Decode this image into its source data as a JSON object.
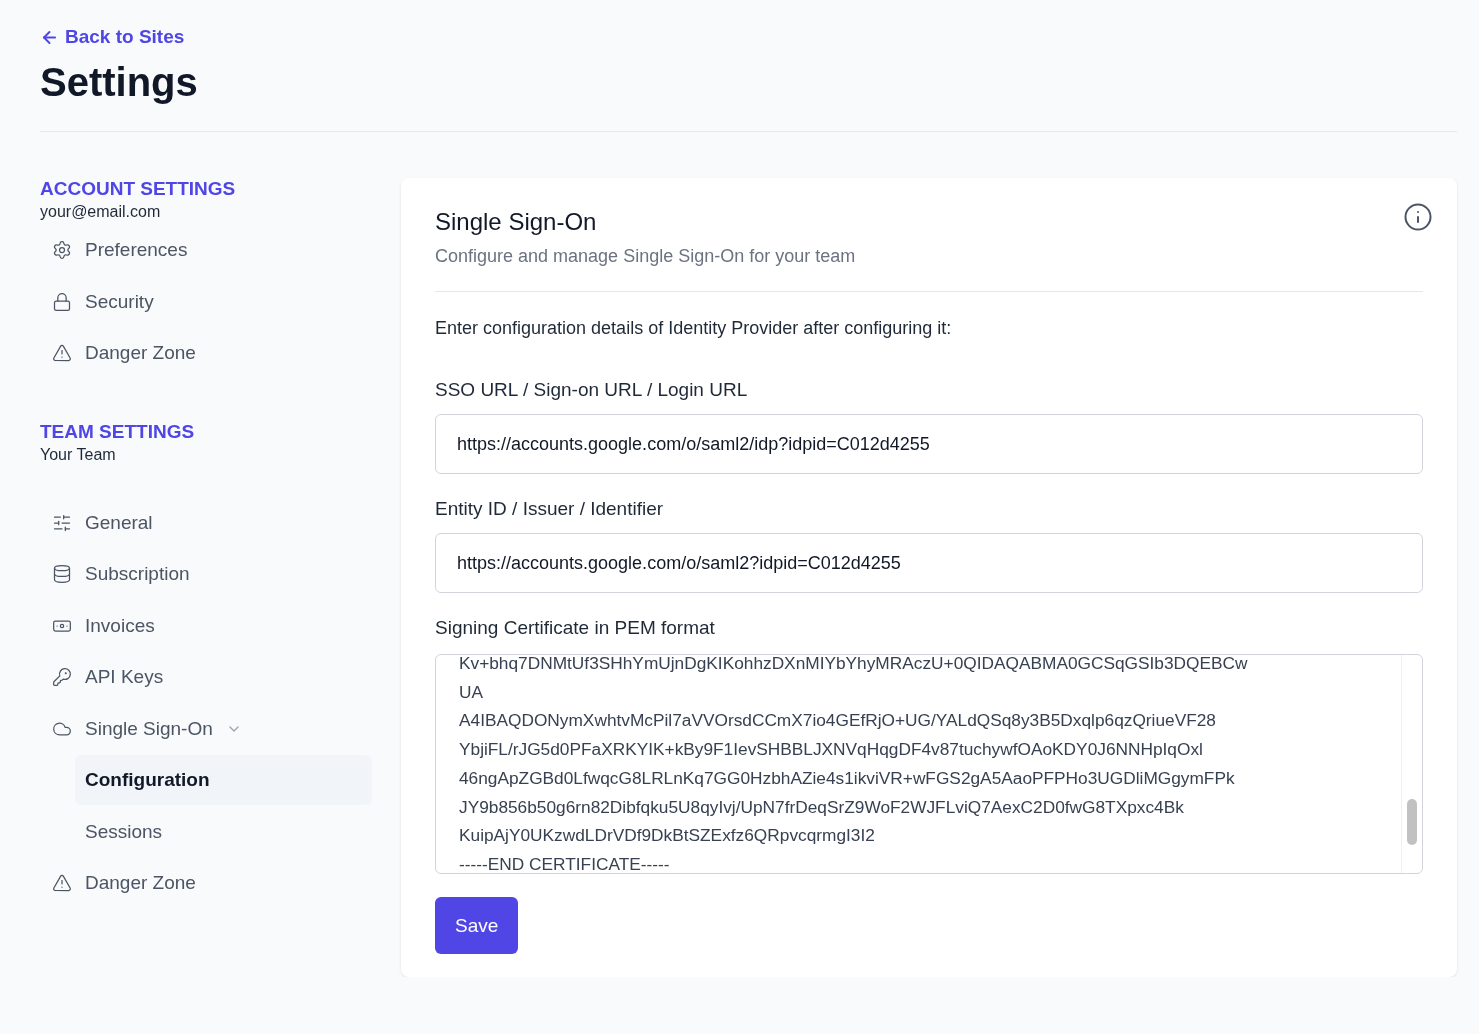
{
  "header": {
    "back_link": "Back to Sites",
    "title": "Settings"
  },
  "sidebar": {
    "sections": [
      {
        "heading": "ACCOUNT SETTINGS",
        "subheading": "your@email.com",
        "items": [
          {
            "label": "Preferences",
            "selected": false
          },
          {
            "label": "Security",
            "selected": false
          },
          {
            "label": "Danger Zone",
            "selected": false
          }
        ]
      },
      {
        "heading": "TEAM SETTINGS",
        "subheading": "Your Team",
        "items": [
          {
            "label": "General",
            "selected": false
          },
          {
            "label": "Subscription",
            "selected": false
          },
          {
            "label": "Invoices",
            "selected": false
          },
          {
            "label": "API Keys",
            "selected": false
          },
          {
            "label": "Single Sign-On",
            "selected": false,
            "expanded": true,
            "children": [
              {
                "label": "Configuration",
                "selected": true
              },
              {
                "label": "Sessions",
                "selected": false
              }
            ]
          },
          {
            "label": "Danger Zone",
            "selected": false
          }
        ]
      }
    ]
  },
  "panel": {
    "title": "Single Sign-On",
    "subtitle": "Configure and manage Single Sign-On for your team",
    "instruction": "Enter configuration details of Identity Provider after configuring it:",
    "fields": [
      {
        "label": "SSO URL / Sign-on URL / Login URL",
        "value": "https://accounts.google.com/o/saml2/idp?idpid=C012d4255"
      },
      {
        "label": "Entity ID / Issuer / Identifier",
        "value": "https://accounts.google.com/o/saml2?idpid=C012d4255"
      }
    ],
    "certificate": {
      "label": "Signing Certificate in PEM format",
      "lines": [
        "Kv+bhq7DNMtUf3SHhYmUjnDgKIKohhzDXnMIYbYhyMRAczU+0QIDAQABMA0GCSqGSIb3DQEBCw",
        "UA",
        "A4IBAQDONymXwhtvMcPil7aVVOrsdCCmX7io4GEfRjO+UG/YALdQSq8y3B5Dxqlp6qzQriueVF28",
        "YbjiFL/rJG5d0PFaXRKYIK+kBy9F1IevSHBBLJXNVqHqgDF4v87tuchywfOAoKDY0J6NNHpIqOxl",
        "46ngApZGBd0LfwqcG8LRLnKq7GG0HzbhAZie4s1ikviVR+wFGS2gA5AaoPFPHo3UGDliMGgymFPk",
        "JY9b856b50g6rn82Dibfqku5U8qyIvj/UpN7frDeqSrZ9WoF2WJFLviQ7AexC2D0fwG8TXpxc4Bk",
        "KuipAjY0UKzwdLDrVDf9DkBtSZExfz6QRpvcqrmgI3I2",
        "-----END CERTIFICATE-----"
      ]
    },
    "save_button": "Save"
  }
}
